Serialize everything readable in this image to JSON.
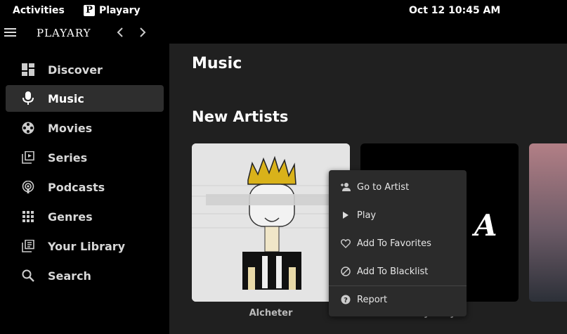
{
  "topbar": {
    "activities": "Activities",
    "app_name": "Playary",
    "app_icon": "P",
    "clock": "Oct 12  10:45 AM"
  },
  "header": {
    "logo": "PLAYARY",
    "back_icon": "chevron-left-icon",
    "forward_icon": "chevron-right-icon"
  },
  "sidebar": {
    "items": [
      {
        "label": "Discover",
        "icon": "dashboard-icon",
        "active": false
      },
      {
        "label": "Music",
        "icon": "microphone-icon",
        "active": true
      },
      {
        "label": "Movies",
        "icon": "film-reel-icon",
        "active": false
      },
      {
        "label": "Series",
        "icon": "library-play-icon",
        "active": false
      },
      {
        "label": "Podcasts",
        "icon": "podcast-icon",
        "active": false
      },
      {
        "label": "Genres",
        "icon": "apps-grid-icon",
        "active": false
      },
      {
        "label": "Your Library",
        "icon": "library-books-icon",
        "active": false
      },
      {
        "label": "Search",
        "icon": "search-icon",
        "active": false
      }
    ]
  },
  "main": {
    "title": "Music",
    "section": "New Artists",
    "cards": [
      {
        "label": "Alcheter"
      },
      {
        "label": "By Delyn",
        "art_text": "A"
      },
      {
        "label": ""
      }
    ]
  },
  "context_menu": {
    "items": [
      {
        "label": "Go to Artist",
        "icon": "person-arrow-icon"
      },
      {
        "label": "Play",
        "icon": "play-icon"
      },
      {
        "label": "Add To Favorites",
        "icon": "heart-icon"
      },
      {
        "label": "Add To Blacklist",
        "icon": "block-icon"
      },
      {
        "label": "Report",
        "icon": "help-circle-icon"
      }
    ]
  },
  "colors": {
    "background": "#000000",
    "main_bg": "#202020",
    "active_item": "#2e2e2e",
    "menu_bg": "#2b2b2b"
  }
}
